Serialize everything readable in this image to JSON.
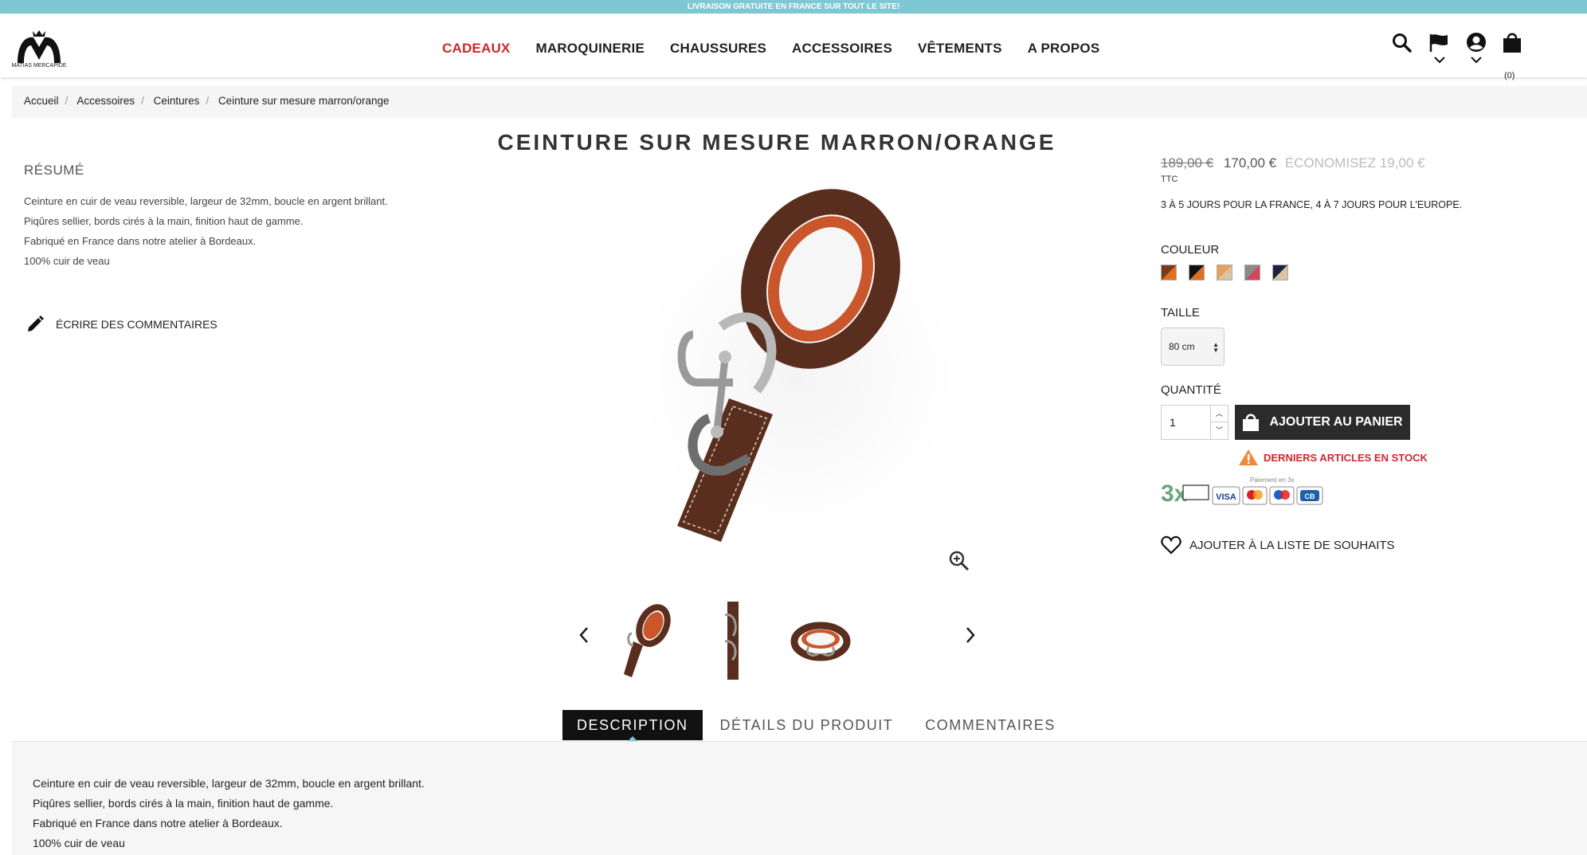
{
  "topbar": {
    "text": "LIVRAISON GRATUITE EN FRANCE SUR TOUT LE SITE!"
  },
  "header": {
    "logo_text": "MATIAS MERCAPIDE",
    "nav": [
      {
        "label": "CADEAUX",
        "active": true
      },
      {
        "label": "MAROQUINERIE",
        "active": false
      },
      {
        "label": "CHAUSSURES",
        "active": false
      },
      {
        "label": "ACCESSOIRES",
        "active": false
      },
      {
        "label": "VÊTEMENTS",
        "active": false
      },
      {
        "label": "A PROPOS",
        "active": false
      }
    ],
    "icons": [
      "search-icon",
      "flag-icon",
      "account-icon",
      "cart-icon"
    ],
    "cart_count": "(0)"
  },
  "breadcrumb": [
    "Accueil",
    "Accessoires",
    "Ceintures",
    "Ceinture sur mesure marron/orange"
  ],
  "product": {
    "title": "CEINTURE SUR MESURE MARRON/ORANGE",
    "resume_heading": "RÉSUMÉ",
    "resume_lines": [
      "Ceinture en cuir de veau reversible, largeur de 32mm, boucle en argent brillant.",
      "Piqûres sellier, bords cirés à la main, finition haut de gamme.",
      "Fabriqué en France dans notre atelier à Bordeaux.",
      "100% cuir de veau"
    ],
    "write_comment": "ÉCRIRE DES COMMENTAIRES",
    "old_price": "189,00 €",
    "price": "170,00 €",
    "savings": "ÉCONOMISEZ 19,00 €",
    "tax_label": "TTC",
    "delivery": "3 À 5 JOURS POUR LA FRANCE, 4 À 7 JOURS POUR L'EUROPE.",
    "color_label": "COULEUR",
    "colors": [
      {
        "a": "#7a3a1e",
        "b": "#e07020"
      },
      {
        "a": "#111111",
        "b": "#e07020"
      },
      {
        "a": "#e8a060",
        "b": "#d9c3a0"
      },
      {
        "a": "#8a8a8a",
        "b": "#d9445a"
      },
      {
        "a": "#1c2340",
        "b": "#d9c3a0"
      }
    ],
    "size_label": "TAILLE",
    "size_value": "80 cm",
    "qty_label": "QUANTITÉ",
    "qty_value": "1",
    "add_to_cart": "AJOUTER AU PANIER",
    "stock_warning": "DERNIERS ARTICLES EN STOCK",
    "payment": {
      "installments": "3x",
      "caption": "Paiement en 3x",
      "cards": [
        "VISA",
        "mastercard",
        "maestro",
        "CB"
      ]
    },
    "wishlist": "AJOUTER À LA LISTE DE SOUHAITS"
  },
  "tabs": [
    {
      "label": "DESCRIPTION",
      "active": true
    },
    {
      "label": "DÉTAILS DU PRODUIT",
      "active": false
    },
    {
      "label": "COMMENTAIRES",
      "active": false
    }
  ],
  "description_lines": [
    "Ceinture en cuir de veau reversible, largeur de 32mm, boucle en argent brillant.",
    "Piqûres sellier, bords cirés à la main, finition haut de gamme.",
    "Fabriqué en France dans notre atelier à Bordeaux.",
    "100% cuir de veau"
  ],
  "colors": {
    "accent_red": "#d3262b",
    "topbar": "#7ec8d4",
    "dark_button": "#2b2b2b"
  }
}
